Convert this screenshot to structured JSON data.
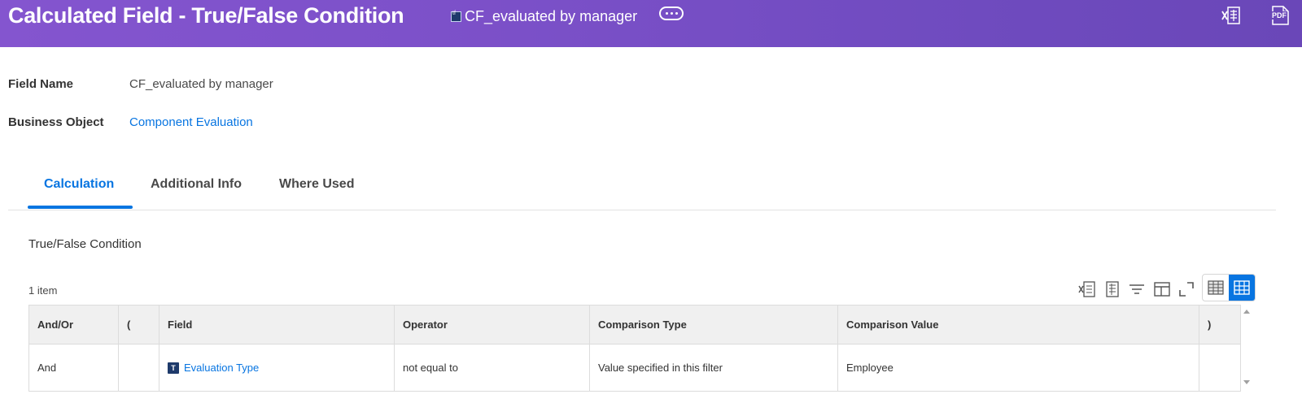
{
  "header": {
    "title": "Calculated Field - True/False Condition",
    "object_name": "CF_evaluated by manager",
    "object_icon": "calculated-field-icon",
    "related_actions_icon": "more-actions-icon",
    "export_excel_icon": "export-excel-icon",
    "export_pdf_icon": "export-pdf-icon",
    "pdf_label": "PDF"
  },
  "fields": {
    "field_name_label": "Field Name",
    "field_name_value": "CF_evaluated by manager",
    "business_object_label": "Business Object",
    "business_object_value": "Component Evaluation"
  },
  "tabs": [
    {
      "label": "Calculation",
      "active": true
    },
    {
      "label": "Additional Info",
      "active": false
    },
    {
      "label": "Where Used",
      "active": false
    }
  ],
  "section": {
    "title": "True/False Condition",
    "item_count": "1 item"
  },
  "grid": {
    "columns": [
      "And/Or",
      "(",
      "Field",
      "Operator",
      "Comparison Type",
      "Comparison Value",
      ")"
    ],
    "rows": [
      {
        "and_or": "And",
        "open_paren": "",
        "field_badge": "T",
        "field": "Evaluation Type",
        "operator": "not equal to",
        "comparison_type": "Value specified in this filter",
        "comparison_value": "Employee",
        "close_paren": ""
      }
    ]
  },
  "colors": {
    "header_start": "#8455cf",
    "header_end": "#6a47b8",
    "accent": "#0875e1"
  }
}
